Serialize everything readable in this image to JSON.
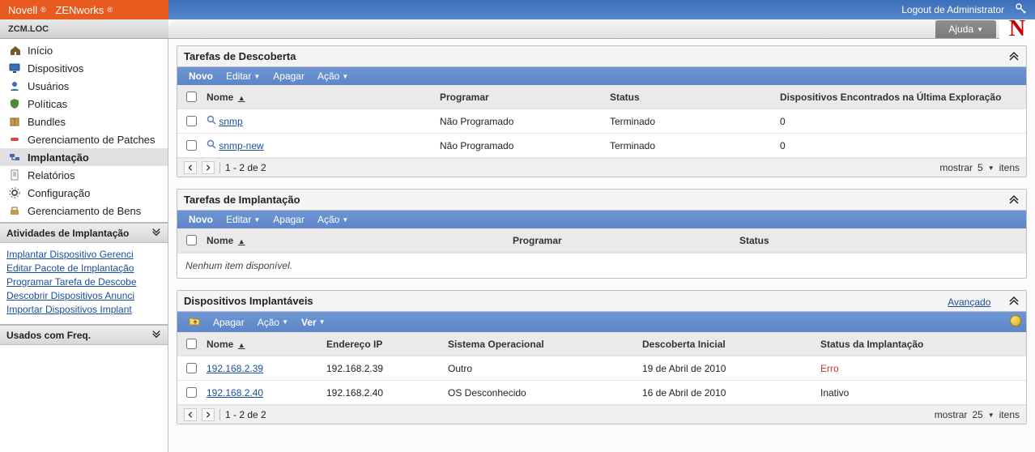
{
  "brand": {
    "name": "Novell",
    "sub1": "®",
    "product": "ZENworks",
    "sub2": "®"
  },
  "top": {
    "logout": "Logout de Administrator",
    "help": "Ajuda",
    "n": "N"
  },
  "breadcrumb": "ZCM.LOC",
  "nav": {
    "items": [
      {
        "label": "Início",
        "icon": "home"
      },
      {
        "label": "Dispositivos",
        "icon": "monitor"
      },
      {
        "label": "Usuários",
        "icon": "user"
      },
      {
        "label": "Políticas",
        "icon": "shield"
      },
      {
        "label": "Bundles",
        "icon": "package"
      },
      {
        "label": "Gerenciamento de Patches",
        "icon": "patch"
      },
      {
        "label": "Implantação",
        "icon": "deploy"
      },
      {
        "label": "Relatórios",
        "icon": "report"
      },
      {
        "label": "Configuração",
        "icon": "gear"
      },
      {
        "label": "Gerenciamento de Bens",
        "icon": "asset"
      }
    ],
    "activeIndex": 6
  },
  "side_sections": {
    "activities_title": "Atividades de Implantação",
    "activities_links": [
      "Implantar Dispositivo Gerenci",
      "Editar Pacote de Implantação",
      "Programar Tarefa de Descobe",
      "Descobrir Dispositivos Anunci",
      "Importar Dispositivos Implant"
    ],
    "freq_title": "Usados com Freq."
  },
  "panel_discover": {
    "title": "Tarefas de Descoberta",
    "toolbar": {
      "novo": "Novo",
      "editar": "Editar",
      "apagar": "Apagar",
      "acao": "Ação"
    },
    "headers": {
      "nome": "Nome",
      "programar": "Programar",
      "status": "Status",
      "disp": "Dispositivos Encontrados na Última Exploração"
    },
    "rows": [
      {
        "nome": "snmp",
        "programar": "Não Programado",
        "status": "Terminado",
        "disp": "0"
      },
      {
        "nome": "snmp-new",
        "programar": "Não Programado",
        "status": "Terminado",
        "disp": "0"
      }
    ],
    "pager": {
      "range": "1 - 2 de 2",
      "show_label": "mostrar",
      "show_count": "5",
      "items_label": "itens"
    }
  },
  "panel_tasks": {
    "title": "Tarefas de Implantação",
    "toolbar": {
      "novo": "Novo",
      "editar": "Editar",
      "apagar": "Apagar",
      "acao": "Ação"
    },
    "headers": {
      "nome": "Nome",
      "programar": "Programar",
      "status": "Status"
    },
    "empty": "Nenhum item disponível."
  },
  "panel_devices": {
    "title": "Dispositivos Implantáveis",
    "advanced": "Avançado",
    "toolbar": {
      "apagar": "Apagar",
      "acao": "Ação",
      "ver": "Ver"
    },
    "headers": {
      "nome": "Nome",
      "ip": "Endereço IP",
      "os": "Sistema Operacional",
      "descoberta": "Descoberta Inicial",
      "status": "Status da Implantação"
    },
    "rows": [
      {
        "nome": "192.168.2.39",
        "ip": "192.168.2.39",
        "os": "Outro",
        "descoberta": "19 de Abril de 2010",
        "status": "Erro",
        "statusClass": "status-error"
      },
      {
        "nome": "192.168.2.40",
        "ip": "192.168.2.40",
        "os": "OS Desconhecido",
        "descoberta": "16 de Abril de 2010",
        "status": "Inativo",
        "statusClass": ""
      }
    ],
    "pager": {
      "range": "1 - 2 de 2",
      "show_label": "mostrar",
      "show_count": "25",
      "items_label": "itens"
    }
  }
}
